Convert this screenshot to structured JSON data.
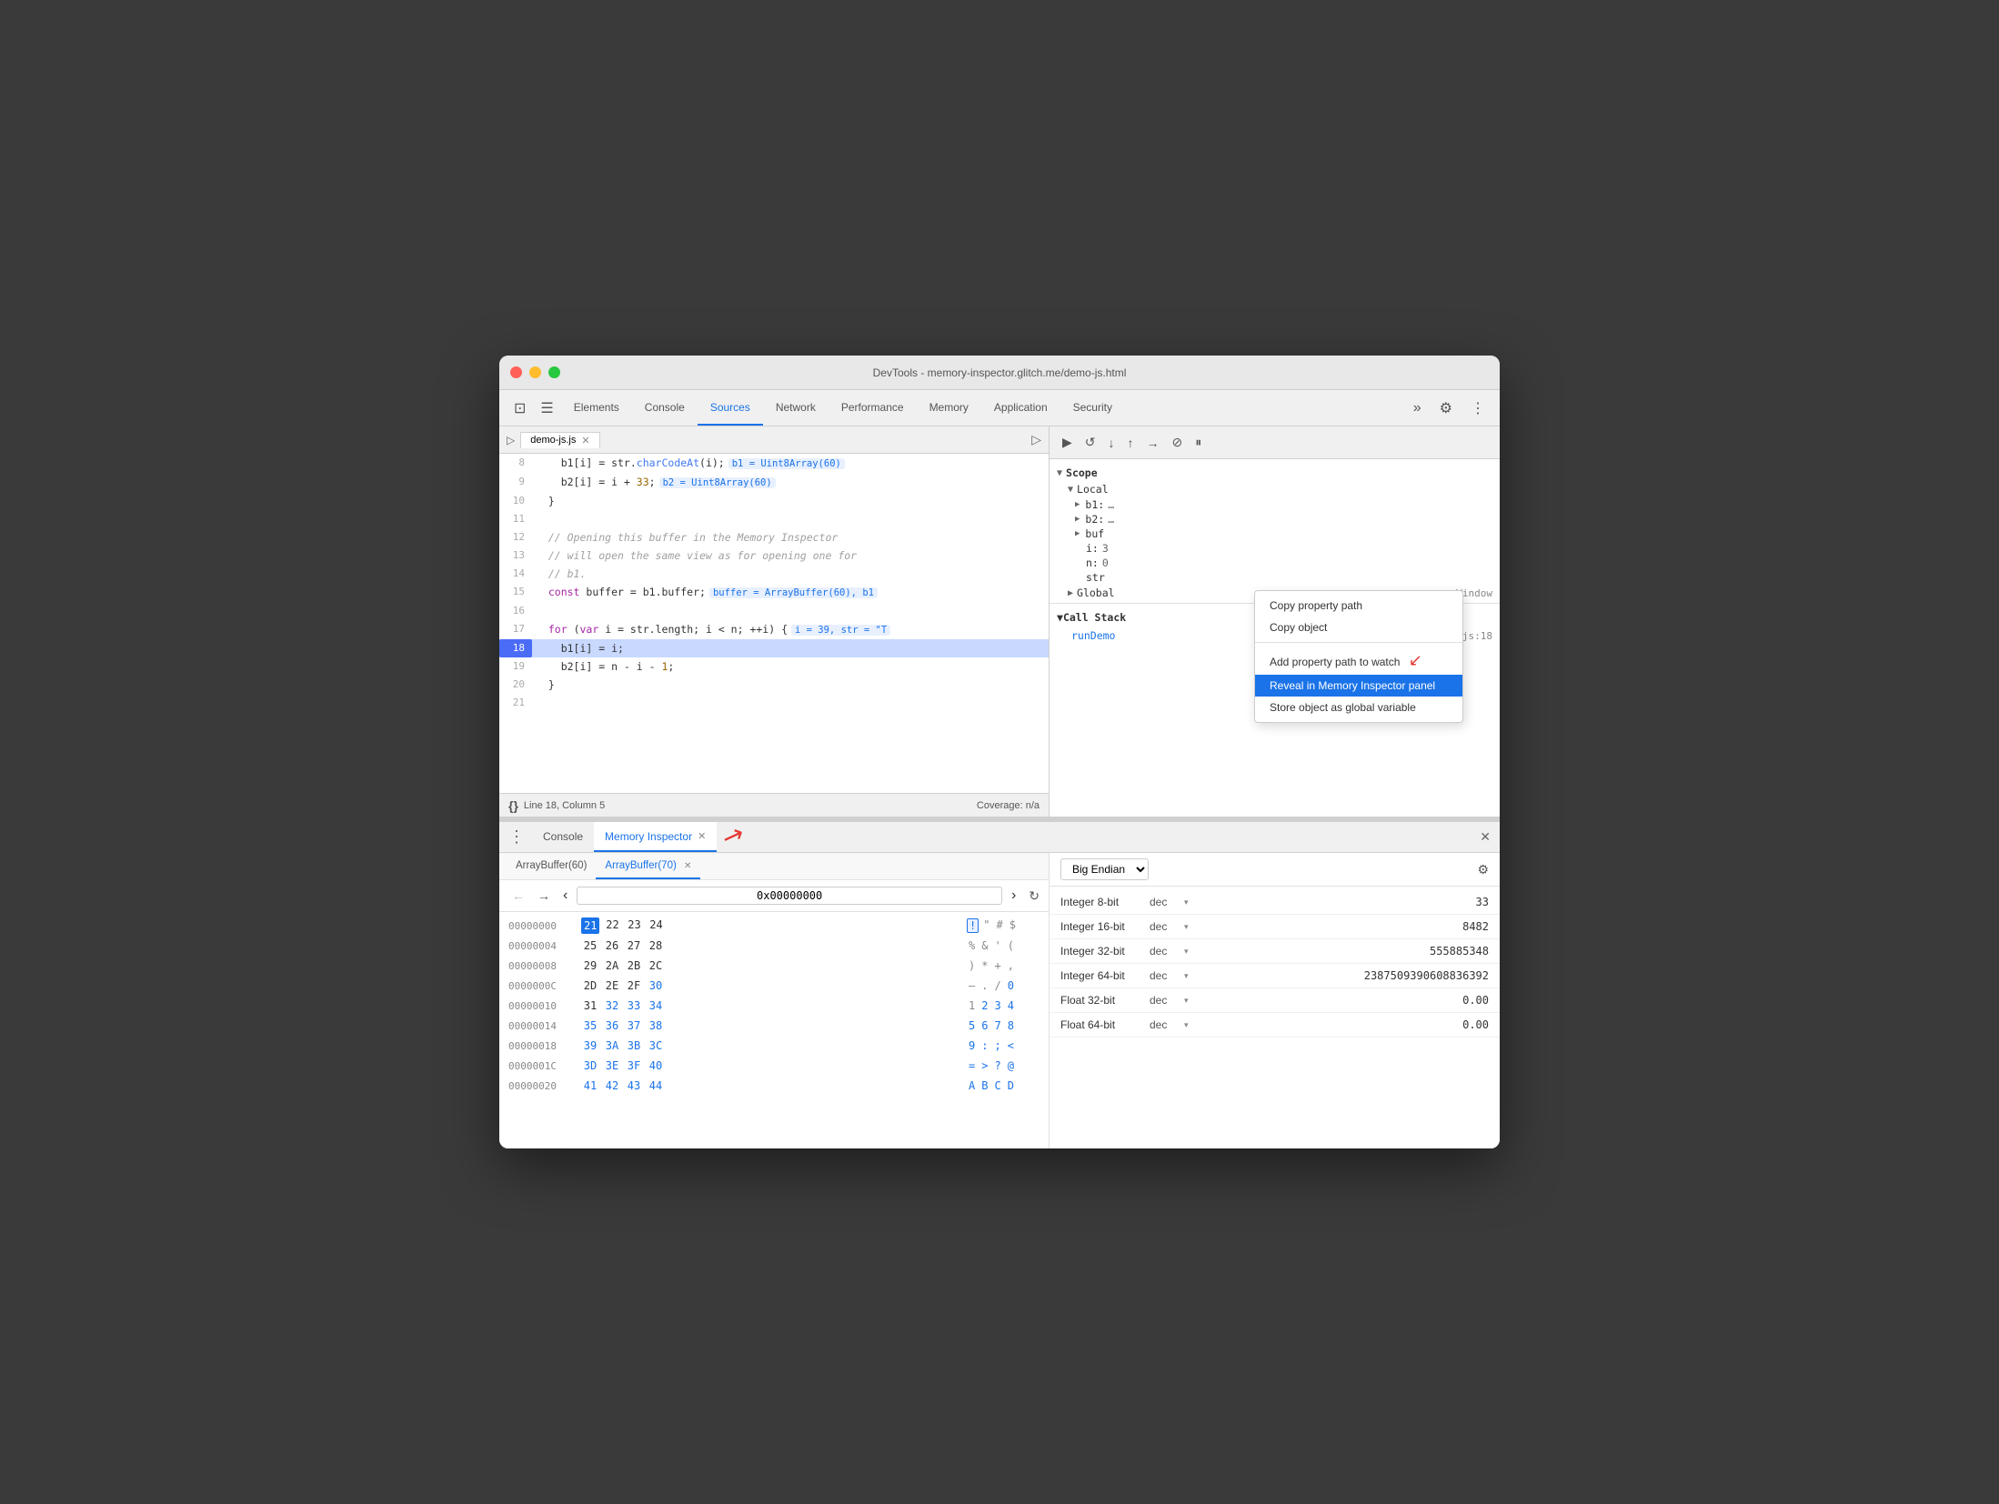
{
  "window": {
    "title": "DevTools - memory-inspector.glitch.me/demo-js.html"
  },
  "nav": {
    "tabs": [
      "Elements",
      "Console",
      "Sources",
      "Network",
      "Performance",
      "Memory",
      "Application",
      "Security"
    ],
    "active_tab": "Sources"
  },
  "sources": {
    "file_tab": "demo-js.js",
    "lines": [
      {
        "num": 8,
        "content": "    b1[i] = str.charCodeAt(i);",
        "inline": "b1 = Uint8Array(60)",
        "type": "normal"
      },
      {
        "num": 9,
        "content": "    b2[i] = i + 33;",
        "inline": "b2 = Uint8Array(60)",
        "type": "normal"
      },
      {
        "num": 10,
        "content": "  }",
        "type": "normal"
      },
      {
        "num": 11,
        "content": "",
        "type": "normal"
      },
      {
        "num": 12,
        "content": "  // Opening this buffer in the Memory Inspector",
        "type": "comment"
      },
      {
        "num": 13,
        "content": "  // will open the same view as for opening one for",
        "type": "comment"
      },
      {
        "num": 14,
        "content": "  // b1.",
        "type": "comment"
      },
      {
        "num": 15,
        "content": "  const buffer = b1.buffer;",
        "inline": "buffer = ArrayBuffer(60), b1",
        "type": "normal"
      },
      {
        "num": 16,
        "content": "",
        "type": "normal"
      },
      {
        "num": 17,
        "content": "  for (var i = str.length; i < n; ++i) {",
        "inline": "i = 39, str = \"T",
        "type": "normal"
      },
      {
        "num": 18,
        "content": "    b1[i] = i;",
        "type": "active"
      },
      {
        "num": 19,
        "content": "    b2[i] = n - i - 1;",
        "type": "normal"
      },
      {
        "num": 20,
        "content": "  }",
        "type": "normal"
      },
      {
        "num": 21,
        "content": "",
        "type": "normal"
      }
    ],
    "status": "Line 18, Column 5",
    "coverage": "Coverage: n/a"
  },
  "scope": {
    "title": "Scope",
    "local_title": "Local",
    "items": [
      {
        "key": "b1:",
        "val": "…",
        "expanded": false
      },
      {
        "key": "b2:",
        "val": "…",
        "expanded": false
      },
      {
        "key": "buf",
        "val": "",
        "expanded": true
      },
      {
        "key": "i:",
        "val": "3",
        "expanded": false
      },
      {
        "key": "n:",
        "val": "0",
        "expanded": false
      },
      {
        "key": "str",
        "val": "",
        "expanded": false
      }
    ],
    "global_title": "Global",
    "global_val": "Window"
  },
  "context_menu": {
    "items": [
      {
        "label": "Copy property path",
        "type": "normal"
      },
      {
        "label": "Copy object",
        "type": "normal"
      },
      {
        "label": "separator"
      },
      {
        "label": "Add property path to watch",
        "type": "normal"
      },
      {
        "label": "Reveal in Memory Inspector panel",
        "type": "active"
      },
      {
        "label": "Store object as global variable",
        "type": "normal"
      }
    ]
  },
  "callstack": {
    "title": "Call Stack",
    "items": [
      {
        "fn": "runDemo",
        "src": "demo-js.js:18"
      }
    ]
  },
  "memory_inspector": {
    "tab_label": "Memory Inspector",
    "console_label": "Console",
    "buffer_tabs": [
      {
        "label": "ArrayBuffer(60)",
        "closeable": false
      },
      {
        "label": "ArrayBuffer(70)",
        "closeable": true,
        "active": true
      }
    ],
    "address": "0x00000000",
    "endian": "Big Endian",
    "rows": [
      {
        "addr": "00000000",
        "bytes": [
          "21",
          "22",
          "23",
          "24"
        ],
        "chars": [
          "!",
          "\"",
          "#",
          "$"
        ],
        "selected": "21"
      },
      {
        "addr": "00000004",
        "bytes": [
          "25",
          "26",
          "27",
          "28"
        ],
        "chars": [
          "%",
          "&",
          "'",
          "("
        ]
      },
      {
        "addr": "00000008",
        "bytes": [
          "29",
          "2A",
          "2B",
          "2C"
        ],
        "chars": [
          ")",
          "*",
          "+",
          ","
        ]
      },
      {
        "addr": "0000000C",
        "bytes": [
          "2D",
          "2E",
          "2F",
          "30"
        ],
        "chars": [
          "-",
          ".",
          "/",
          "0"
        ],
        "char_color": [
          false,
          false,
          false,
          true
        ]
      },
      {
        "addr": "00000010",
        "bytes": [
          "31",
          "32",
          "33",
          "34"
        ],
        "chars": [
          "1",
          "2",
          "3",
          "4"
        ],
        "char_color": [
          false,
          true,
          true,
          true
        ]
      },
      {
        "addr": "00000014",
        "bytes": [
          "35",
          "36",
          "37",
          "38"
        ],
        "chars": [
          "5",
          "6",
          "7",
          "8"
        ],
        "char_color": [
          true,
          true,
          true,
          true
        ]
      },
      {
        "addr": "00000018",
        "bytes": [
          "39",
          "3A",
          "3B",
          "3C"
        ],
        "chars": [
          "9",
          ":",
          ";",
          "<"
        ],
        "char_color": [
          true,
          true,
          true,
          true
        ]
      },
      {
        "addr": "0000001C",
        "bytes": [
          "3D",
          "3E",
          "3F",
          "40"
        ],
        "chars": [
          "=",
          ">",
          "?",
          "@"
        ],
        "char_color": [
          true,
          true,
          true,
          true
        ]
      },
      {
        "addr": "00000020",
        "bytes": [
          "41",
          "42",
          "43",
          "44"
        ],
        "chars": [
          "A",
          "B",
          "C",
          "D"
        ],
        "char_color": [
          true,
          true,
          true,
          true
        ]
      }
    ],
    "data_types": [
      {
        "label": "Integer 8-bit",
        "format": "dec",
        "value": "33"
      },
      {
        "label": "Integer 16-bit",
        "format": "dec",
        "value": "8482"
      },
      {
        "label": "Integer 32-bit",
        "format": "dec",
        "value": "555885348"
      },
      {
        "label": "Integer 64-bit",
        "format": "dec",
        "value": "2387509390608836392"
      },
      {
        "label": "Float 32-bit",
        "format": "dec",
        "value": "0.00"
      },
      {
        "label": "Float 64-bit",
        "format": "dec",
        "value": "0.00"
      }
    ]
  }
}
